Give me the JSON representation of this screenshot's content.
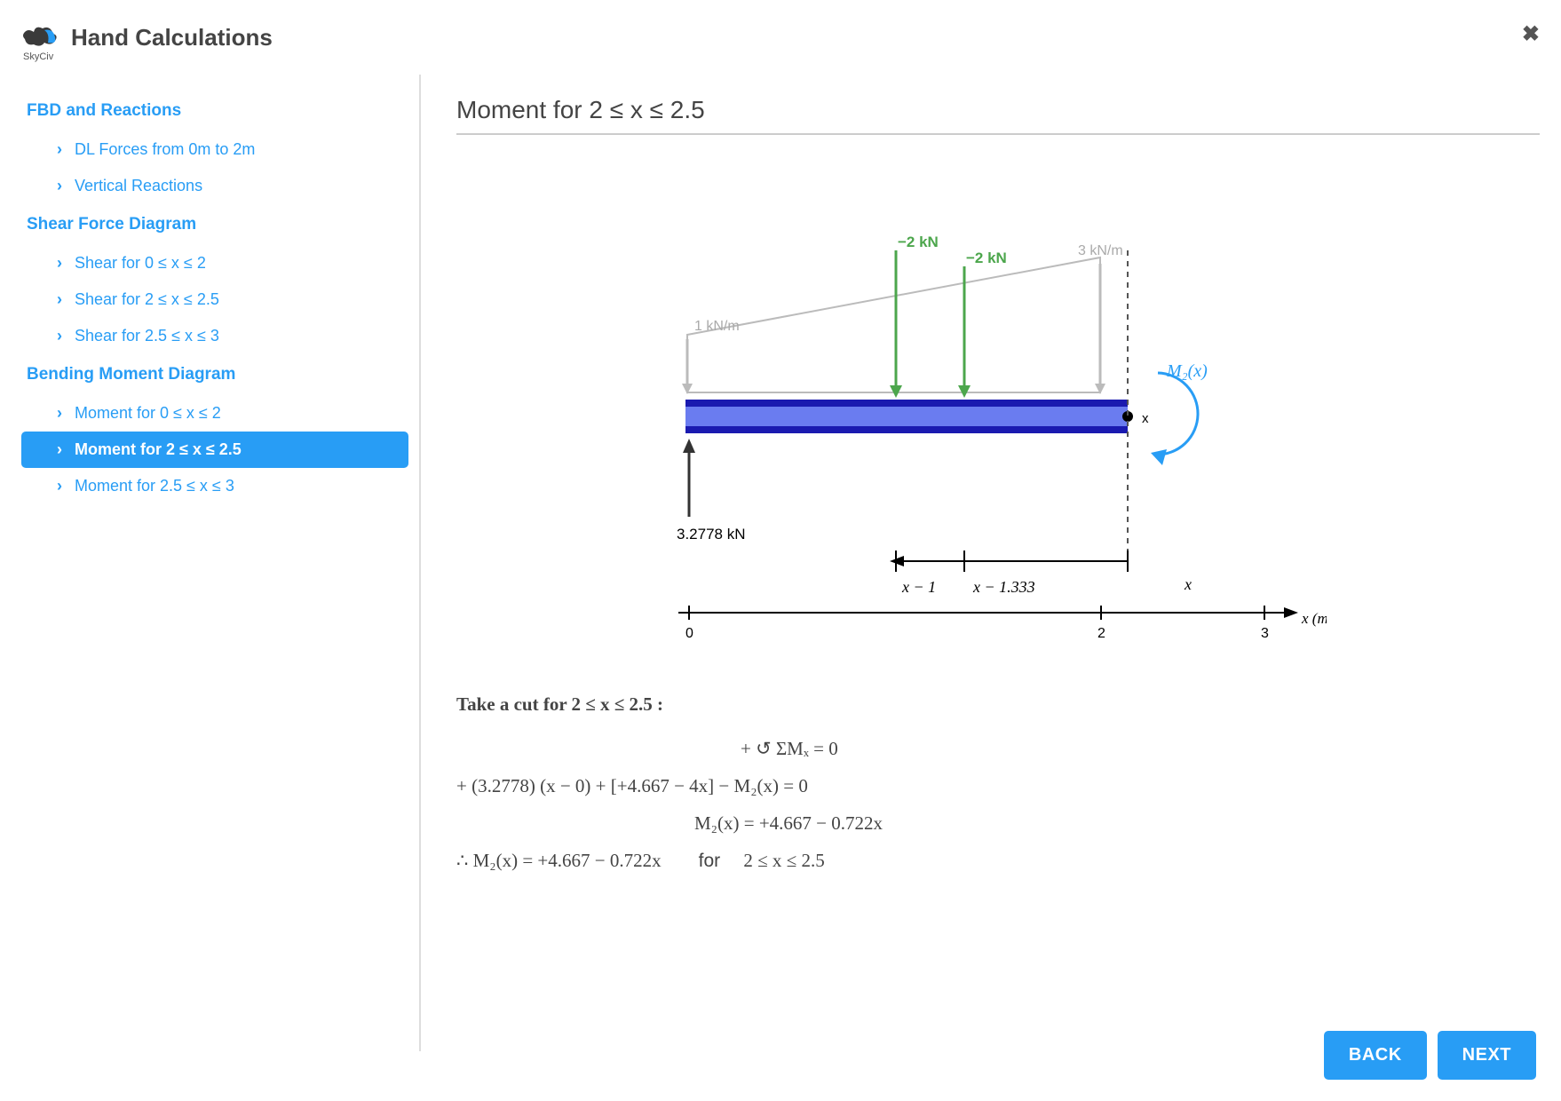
{
  "header": {
    "logo_text": "SkyCiv",
    "title": "Hand Calculations"
  },
  "sidebar": {
    "sections": [
      {
        "label": "FBD and Reactions",
        "items": [
          {
            "label": "DL Forces from 0m to 2m",
            "active": false
          },
          {
            "label": "Vertical Reactions",
            "active": false
          }
        ]
      },
      {
        "label": "Shear Force Diagram",
        "items": [
          {
            "label": "Shear for 0 ≤ x ≤ 2",
            "active": false
          },
          {
            "label": "Shear for 2 ≤ x ≤ 2.5",
            "active": false
          },
          {
            "label": "Shear for 2.5 ≤ x ≤ 3",
            "active": false
          }
        ]
      },
      {
        "label": "Bending Moment Diagram",
        "items": [
          {
            "label": "Moment for 0 ≤ x ≤ 2",
            "active": false
          },
          {
            "label": "Moment for 2 ≤ x ≤ 2.5",
            "active": true
          },
          {
            "label": "Moment for 2.5 ≤ x ≤ 3",
            "active": false
          }
        ]
      }
    ]
  },
  "main": {
    "title": "Moment for 2 ≤ x ≤ 2.5",
    "diagram": {
      "forces": {
        "reaction": "3.2778 kN",
        "point1": "−2 kN",
        "point2": "−2 kN",
        "dist_left": "1 kN/m",
        "dist_right": "3 kN/m",
        "moment_label": "M₂(x)",
        "cut_label": "x"
      },
      "dimensions": {
        "d1": "x − 1",
        "d2": "x − 1.333",
        "axis_label": "x",
        "x_unit": "x (m)",
        "ticks": [
          "0",
          "2",
          "3"
        ]
      }
    },
    "calc": {
      "intro": "Take a cut for 2 ≤ x ≤ 2.5 :",
      "line1": "+ ↺ ΣMₓ = 0",
      "line2": "+ (3.2778) (x − 0) + [+4.667 − 4x] − M₂(x) = 0",
      "line3": "M₂(x) = +4.667 − 0.722x",
      "line4_left": "∴ M₂(x) = +4.667 − 0.722x",
      "line4_mid": "for",
      "line4_right": "2 ≤ x ≤ 2.5"
    }
  },
  "footer": {
    "back": "BACK",
    "next": "NEXT"
  }
}
